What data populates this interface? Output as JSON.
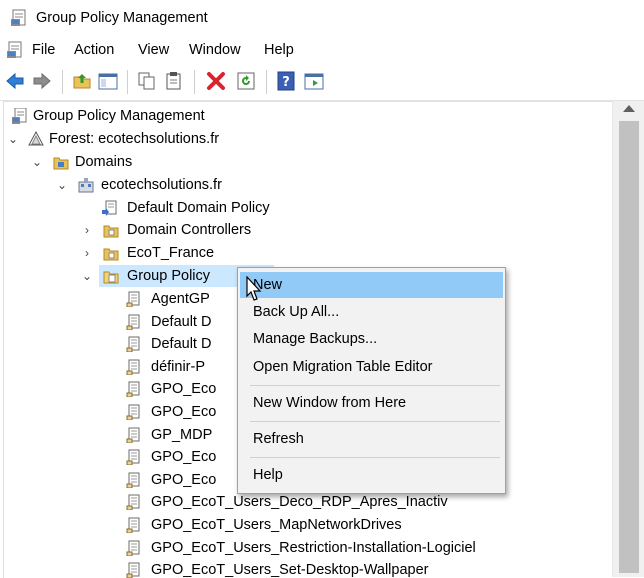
{
  "window": {
    "title": "Group Policy Management"
  },
  "menu": {
    "items": [
      {
        "label": "File"
      },
      {
        "label": "Action"
      },
      {
        "label": "View"
      },
      {
        "label": "Window"
      },
      {
        "label": "Help"
      }
    ]
  },
  "toolbar": {
    "buttons": [
      {
        "icon": "back-arrow-icon"
      },
      {
        "icon": "forward-arrow-icon"
      },
      {
        "icon": "up-folder-icon"
      },
      {
        "icon": "show-hide-tree-icon"
      },
      {
        "icon": "copy-icon"
      },
      {
        "icon": "paste-icon"
      },
      {
        "icon": "delete-icon"
      },
      {
        "icon": "refresh-icon"
      },
      {
        "icon": "help-icon"
      },
      {
        "icon": "properties-icon"
      }
    ]
  },
  "tree": {
    "root": "Group Policy Management",
    "forest": "Forest: ecotechsolutions.fr",
    "domains": "Domains",
    "domain": "ecotechsolutions.fr",
    "default_domain_policy": "Default Domain Policy",
    "domain_controllers": "Domain Controllers",
    "ecot_france": "EcoT_France",
    "gpo_container": "Group Policy Objects",
    "gpo_container_visible": "Group Policy",
    "gpos": [
      "AgentGP",
      "Default D",
      "Default D",
      "définir-P",
      "GPO_Eco",
      "GPO_Eco",
      "GP_MDP",
      "GPO_Eco",
      "GPO_Eco",
      "GPO_EcoT_Users_Deco_RDP_Apres_Inactiv",
      "GPO_EcoT_Users_MapNetworkDrives",
      "GPO_EcoT_Users_Restriction-Installation-Logiciel",
      "GPO_EcoT_Users_Set-Desktop-Wallpaper"
    ]
  },
  "context_menu": {
    "items": [
      {
        "label": "New",
        "selected": true
      },
      {
        "label": "Back Up All..."
      },
      {
        "label": "Manage Backups..."
      },
      {
        "label": "Open Migration Table Editor"
      },
      {
        "label": "New Window from Here"
      },
      {
        "label": "Refresh"
      },
      {
        "label": "Help"
      }
    ]
  },
  "colors": {
    "selection": "#cce8ff",
    "menu_highlight": "#91c9f7",
    "menu_background": "#f2f2f2"
  }
}
